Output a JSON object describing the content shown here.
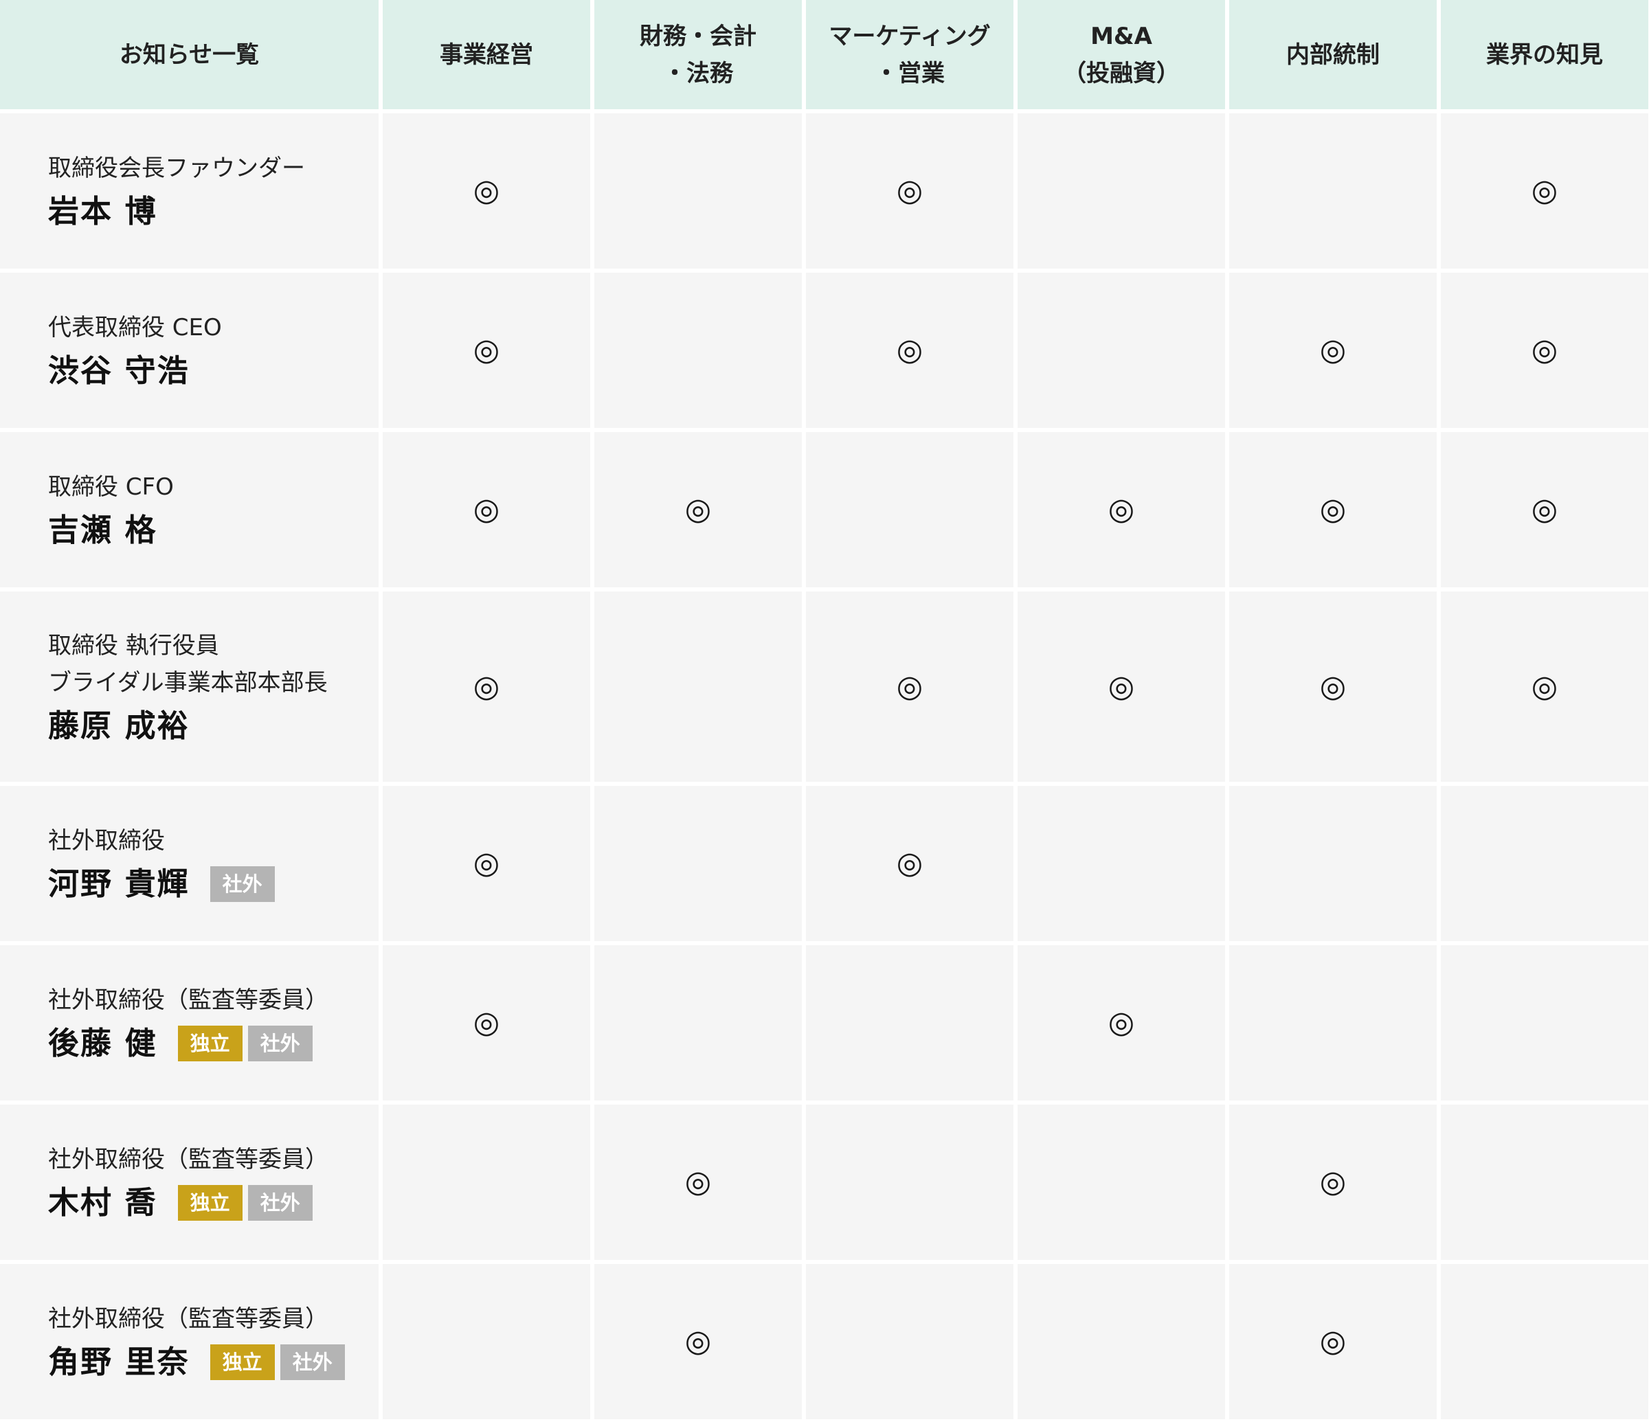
{
  "table": {
    "headers": [
      "お知らせ一覧",
      "事業経営",
      "財務・会計\n・法務",
      "マーケティング\n・営業",
      "M&A\n（投融資）",
      "内部統制",
      "業界の知見"
    ],
    "mark_symbol": "◎",
    "badge_colors": {
      "independent": "#c9a21a",
      "external": "#b4b4b4"
    },
    "rows": [
      {
        "title": "取締役会長ファウンダー",
        "name": "岩本 博",
        "badges": [],
        "marks": [
          "◎",
          "",
          "◎",
          "",
          "",
          "◎"
        ]
      },
      {
        "title": "代表取締役 CEO",
        "name": "渋谷 守浩",
        "badges": [],
        "marks": [
          "◎",
          "",
          "◎",
          "",
          "◎",
          "◎"
        ]
      },
      {
        "title": "取締役 CFO",
        "name": "吉瀬 格",
        "badges": [],
        "marks": [
          "◎",
          "◎",
          "",
          "◎",
          "◎",
          "◎"
        ]
      },
      {
        "title": "取締役 執行役員\nブライダル事業本部本部長",
        "name": "藤原 成裕",
        "badges": [],
        "marks": [
          "◎",
          "",
          "◎",
          "◎",
          "◎",
          "◎"
        ]
      },
      {
        "title": "社外取締役",
        "name": "河野 貴輝",
        "badges": [
          {
            "type": "external",
            "label": "社外"
          }
        ],
        "marks": [
          "◎",
          "",
          "◎",
          "",
          "",
          ""
        ]
      },
      {
        "title": "社外取締役（監査等委員）",
        "name": "後藤 健",
        "badges": [
          {
            "type": "independent",
            "label": "独立"
          },
          {
            "type": "external",
            "label": "社外"
          }
        ],
        "marks": [
          "◎",
          "",
          "",
          "◎",
          "",
          ""
        ]
      },
      {
        "title": "社外取締役（監査等委員）",
        "name": "木村 喬",
        "badges": [
          {
            "type": "independent",
            "label": "独立"
          },
          {
            "type": "external",
            "label": "社外"
          }
        ],
        "marks": [
          "",
          "◎",
          "",
          "",
          "◎",
          ""
        ]
      },
      {
        "title": "社外取締役（監査等委員）",
        "name": "角野 里奈",
        "badges": [
          {
            "type": "independent",
            "label": "独立"
          },
          {
            "type": "external",
            "label": "社外"
          }
        ],
        "marks": [
          "",
          "◎",
          "",
          "",
          "◎",
          ""
        ]
      }
    ]
  }
}
